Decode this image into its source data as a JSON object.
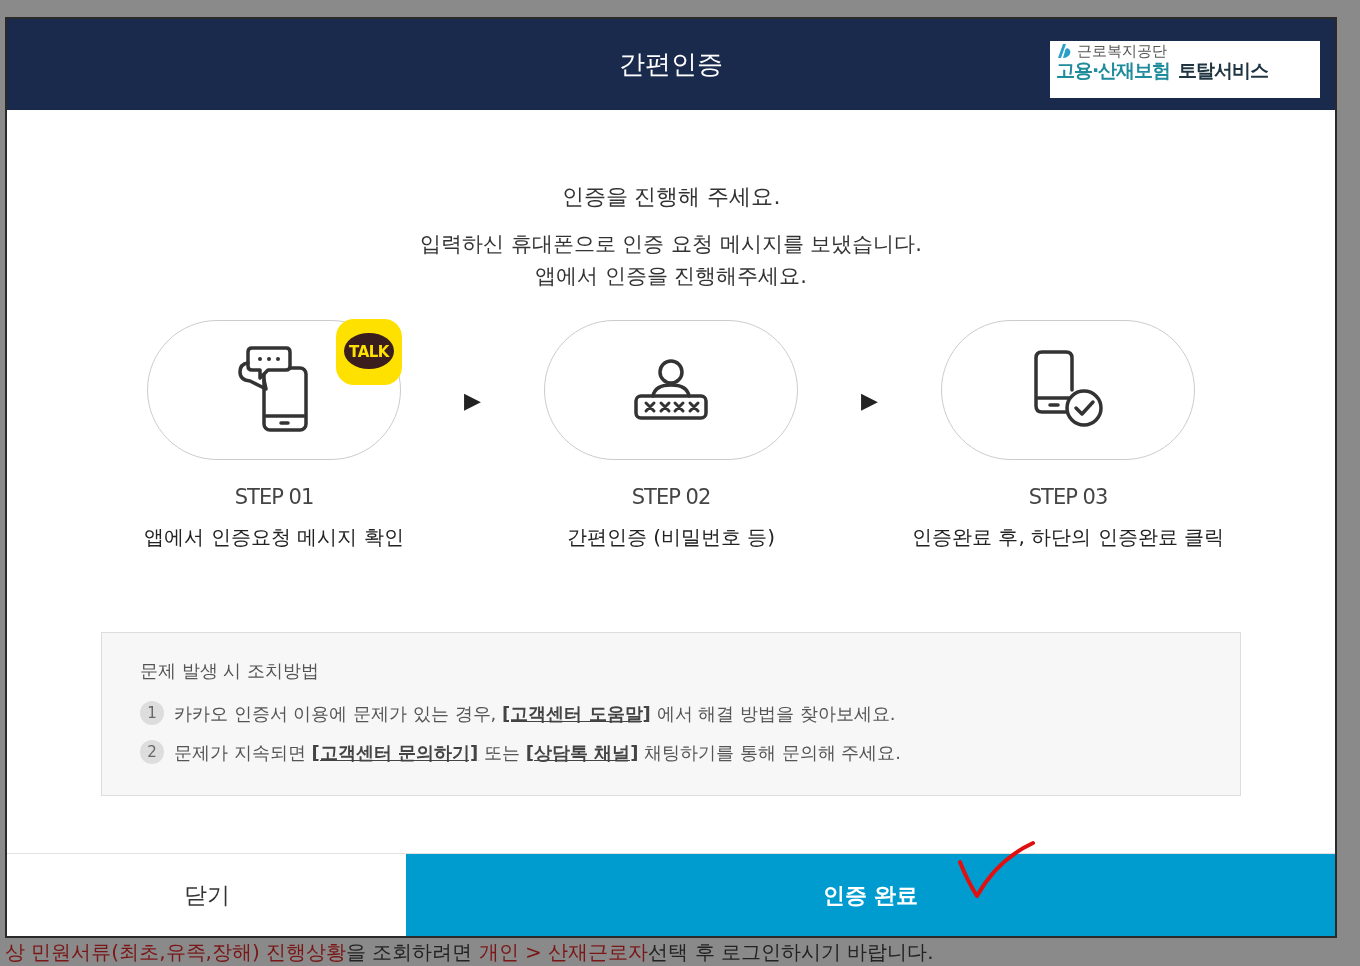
{
  "modal": {
    "title": "간편인증",
    "logo": {
      "org": "근로복지공단",
      "service": "고용·산재보험",
      "suffix": "토탈서비스"
    },
    "intro": {
      "heading": "인증을 진행해 주세요.",
      "lines": [
        "입력하신 휴대폰으로 인증 요청 메시지를 보냈습니다.",
        "앱에서 인증을 진행해주세요."
      ]
    },
    "steps": [
      {
        "kind": "chat-phone",
        "badge": "TALK",
        "label": "STEP 01",
        "description": "앱에서 인증요청 메시지 확인"
      },
      {
        "kind": "password",
        "label": "STEP 02",
        "description": "간편인증 (비밀번호 등)"
      },
      {
        "kind": "phone-check",
        "label": "STEP 03",
        "description": "인증완료 후, 하단의 인증완료 클릭"
      }
    ],
    "step_arrows": [
      "▶",
      "▶"
    ],
    "help": {
      "title": "문제 발생 시 조치방법",
      "items": [
        {
          "number": "1",
          "parts": [
            {
              "kind": "text",
              "text": "카카오 인증서 이용에 문제가 있는 경우, "
            },
            {
              "kind": "link",
              "text": "[고객센터 도움말]"
            },
            {
              "kind": "text",
              "text": " 에서 해결 방법을 찾아보세요."
            }
          ]
        },
        {
          "number": "2",
          "parts": [
            {
              "kind": "text",
              "text": "문제가 지속되면 "
            },
            {
              "kind": "link",
              "text": "[고객센터 문의하기]"
            },
            {
              "kind": "text",
              "text": " 또는 "
            },
            {
              "kind": "link",
              "text": "[상담톡 채널]"
            },
            {
              "kind": "text",
              "text": " 채팅하기를 통해 문의해 주세요."
            }
          ]
        }
      ]
    },
    "buttons": [
      {
        "kind": "close",
        "label": "닫기"
      },
      {
        "kind": "confirm",
        "label": "인증 완료",
        "annotated": true
      }
    ]
  },
  "background_notice": [
    {
      "kind": "highlight",
      "text": "상 민원서류(최초,유족,장해) 진행상황"
    },
    {
      "kind": "text",
      "text": "을 조회하려면 "
    },
    {
      "kind": "highlight",
      "text": "개인 > 산재근로자"
    },
    {
      "kind": "text",
      "text": "선택 후 로그인하시기 바랍니다."
    }
  ]
}
